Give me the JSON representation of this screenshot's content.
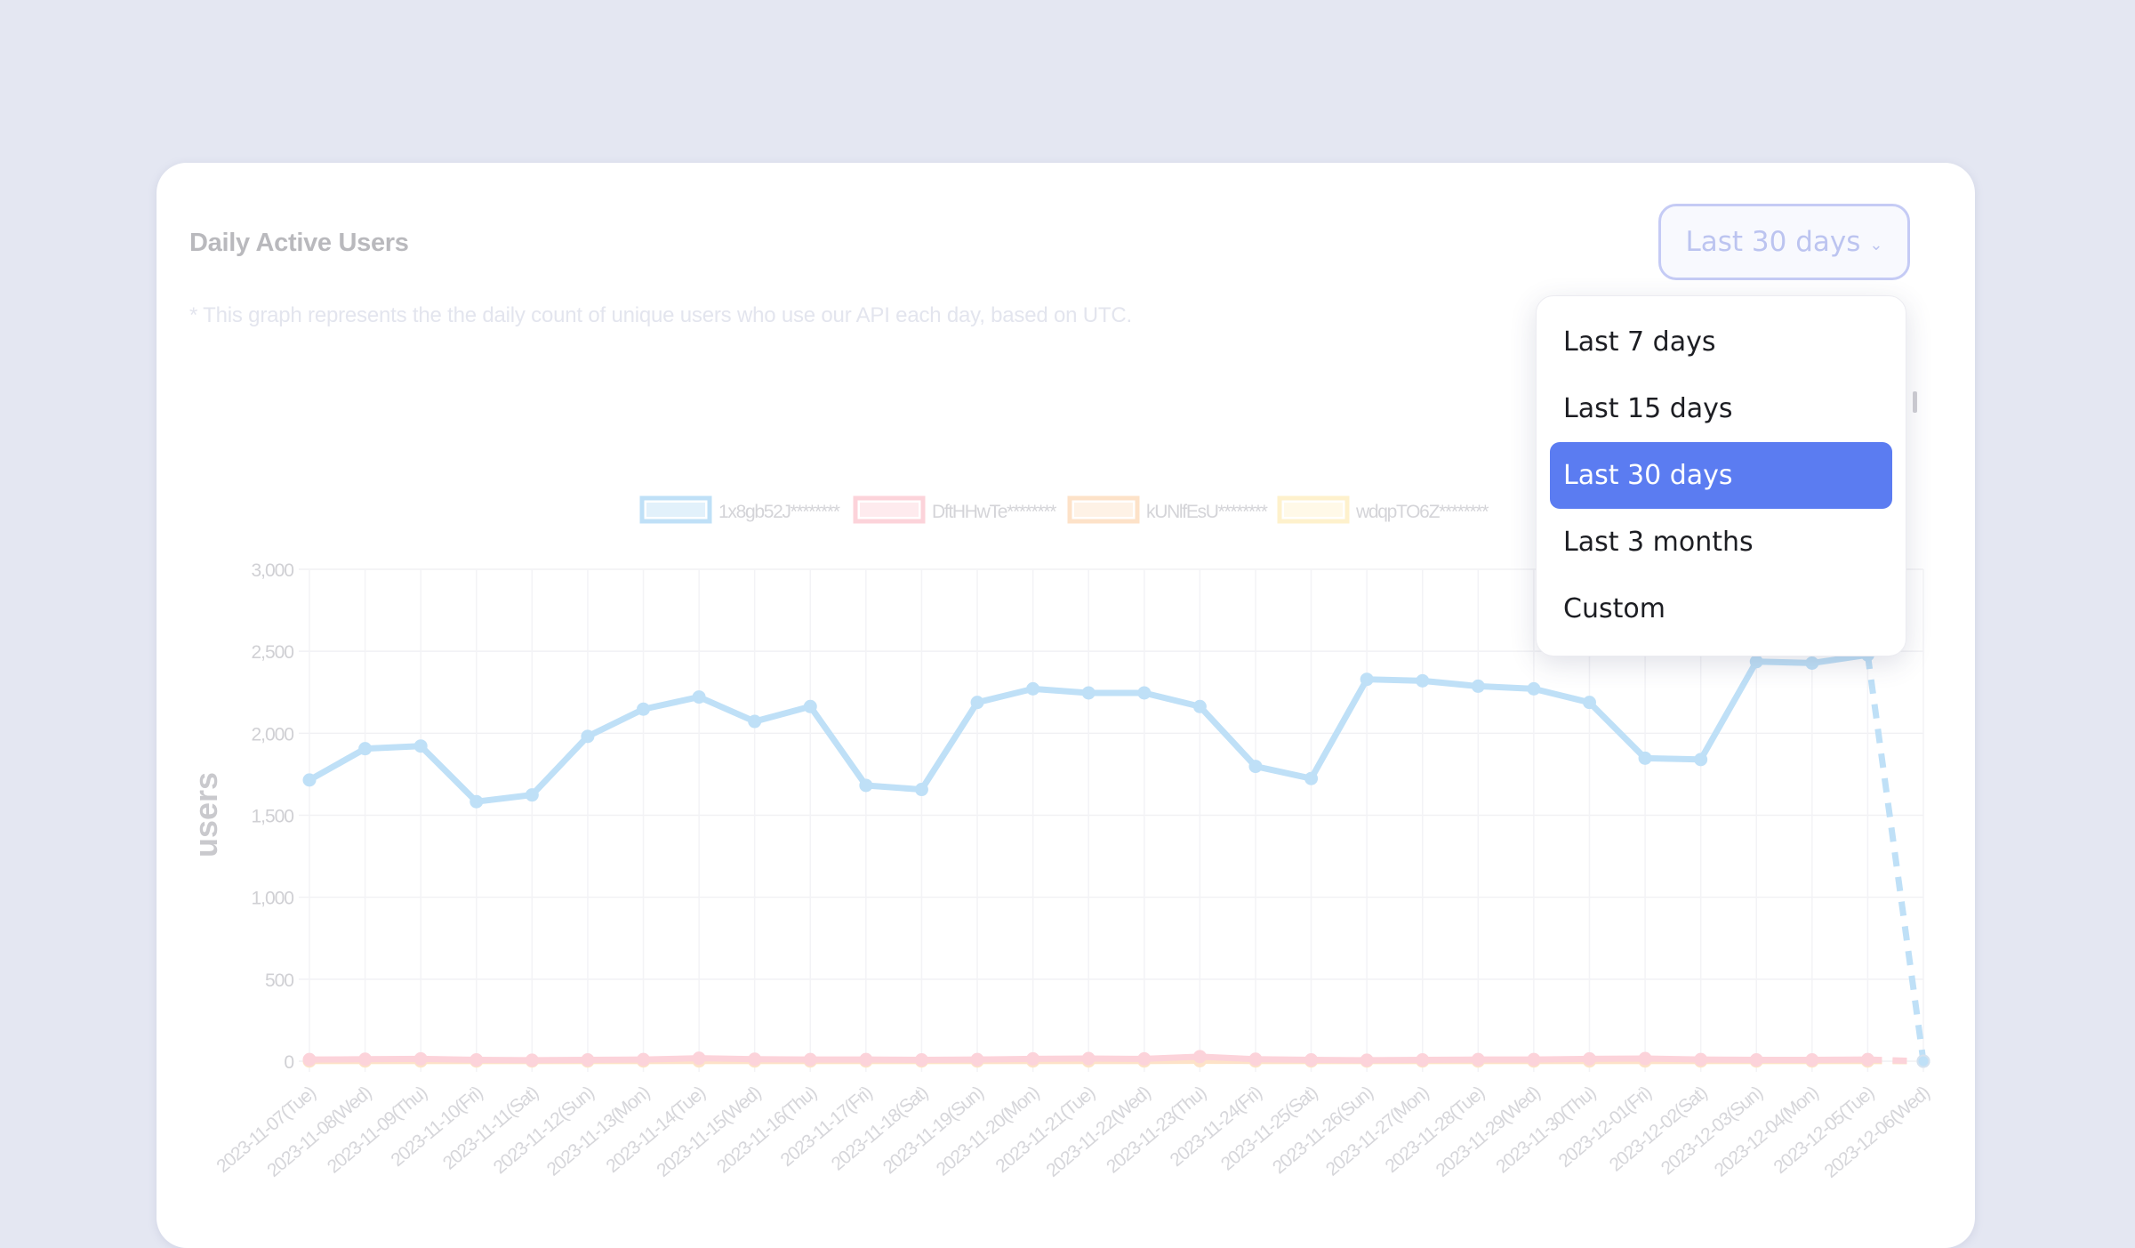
{
  "card": {
    "title": "Daily Active Users",
    "subtitle": "* This graph represents the the daily count of unique users who use our API each day, based on UTC."
  },
  "range_selector": {
    "selected": "Last 30 days",
    "chevron_icon": "chevron-down-icon",
    "options": [
      {
        "label": "Last 7 days",
        "selected": false
      },
      {
        "label": "Last 15 days",
        "selected": false
      },
      {
        "label": "Last 30 days",
        "selected": true
      },
      {
        "label": "Last 3 months",
        "selected": false
      },
      {
        "label": "Custom",
        "selected": false
      }
    ]
  },
  "colors": {
    "accent": "#5b7cf1",
    "series_blue": "#bfe0f7",
    "series_pink": "#fcd3da",
    "series_orange": "#fde2c8",
    "series_yellow": "#fef1cc"
  },
  "chart_data": {
    "type": "line",
    "title": "",
    "xlabel": "",
    "ylabel": "users",
    "ylim": [
      0,
      3000
    ],
    "yticks": [
      0,
      500,
      1000,
      1500,
      2000,
      2500,
      3000
    ],
    "ytick_labels": [
      "0",
      "500",
      "1,000",
      "1,500",
      "2,000",
      "2,500",
      "3,000"
    ],
    "grid": true,
    "legend_position": "top-center",
    "categories": [
      "2023-11-07(Tue)",
      "2023-11-08(Wed)",
      "2023-11-09(Thu)",
      "2023-11-10(Fri)",
      "2023-11-11(Sat)",
      "2023-11-12(Sun)",
      "2023-11-13(Mon)",
      "2023-11-14(Tue)",
      "2023-11-15(Wed)",
      "2023-11-16(Thu)",
      "2023-11-17(Fri)",
      "2023-11-18(Sat)",
      "2023-11-19(Sun)",
      "2023-11-20(Mon)",
      "2023-11-21(Tue)",
      "2023-11-22(Wed)",
      "2023-11-23(Thu)",
      "2023-11-24(Fri)",
      "2023-11-25(Sat)",
      "2023-11-26(Sun)",
      "2023-11-27(Mon)",
      "2023-11-28(Tue)",
      "2023-11-29(Wed)",
      "2023-11-30(Thu)",
      "2023-12-01(Fri)",
      "2023-12-02(Sat)",
      "2023-12-03(Sun)",
      "2023-12-04(Mon)",
      "2023-12-05(Tue)",
      "2023-12-06(Wed)"
    ],
    "series": [
      {
        "name": "1x8gb52J********",
        "color": "#bfe0f7",
        "dashed_last_segment": true,
        "values": [
          1715,
          1906,
          1922,
          1583,
          1624,
          1981,
          2147,
          2221,
          2072,
          2163,
          1682,
          1657,
          2188,
          2271,
          2246,
          2246,
          2163,
          1798,
          1724,
          2329,
          2320,
          2287,
          2271,
          2188,
          1848,
          1840,
          2437,
          2428,
          2478,
          0
        ]
      },
      {
        "name": "DftHHwTe********",
        "color": "#fcd3da",
        "dashed_last_segment": true,
        "values": [
          10,
          12,
          14,
          8,
          6,
          8,
          10,
          18,
          12,
          10,
          10,
          8,
          10,
          14,
          16,
          14,
          28,
          12,
          8,
          6,
          8,
          10,
          10,
          14,
          16,
          10,
          8,
          8,
          10,
          0
        ]
      },
      {
        "name": "kUNlfEsU********",
        "color": "#fde2c8",
        "dashed_last_segment": true,
        "values": [
          2,
          2,
          2,
          2,
          2,
          2,
          2,
          3,
          2,
          2,
          2,
          2,
          2,
          2,
          3,
          2,
          4,
          2,
          2,
          2,
          2,
          2,
          2,
          2,
          2,
          2,
          2,
          2,
          2,
          0
        ]
      },
      {
        "name": "wdqpTO6Z********",
        "color": "#fef1cc",
        "dashed_last_segment": true,
        "values": [
          1,
          1,
          1,
          1,
          1,
          1,
          1,
          1,
          1,
          1,
          1,
          1,
          1,
          1,
          1,
          1,
          2,
          1,
          1,
          1,
          1,
          1,
          1,
          1,
          1,
          1,
          1,
          1,
          1,
          0
        ]
      }
    ]
  }
}
